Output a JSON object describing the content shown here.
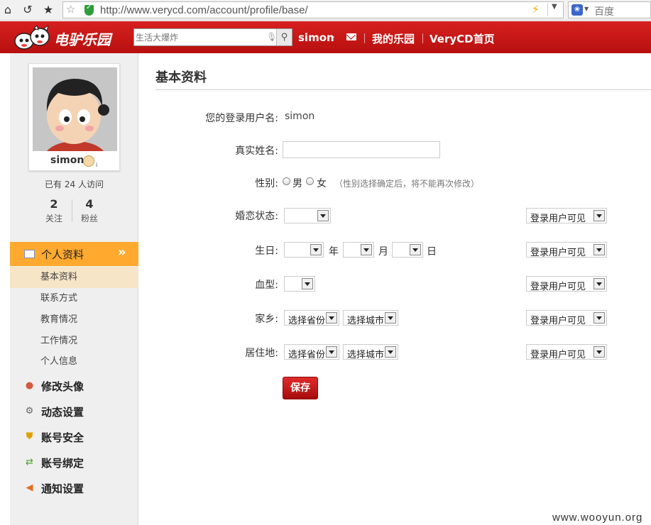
{
  "browser": {
    "url": "http://www.verycd.com/account/profile/base/",
    "search_engine": "百度",
    "icons": [
      "home-icon",
      "refresh-icon",
      "bookmark-star-icon",
      "add-bookmark-icon",
      "secure-shield-icon",
      "lightning-icon",
      "baidu-paw-icon"
    ]
  },
  "header": {
    "logo_text": "电驴乐园",
    "search_placeholder": "生活大爆炸",
    "username": "simon",
    "links": [
      "我的乐园",
      "VeryCD首页"
    ],
    "colors": {
      "header_red": "#c4161c",
      "accent_orange": "#ffa92f"
    }
  },
  "sidebar": {
    "name": "simon",
    "medal_sub": "i",
    "visits_text": "已有 24 人访问",
    "stats": [
      {
        "num": "2",
        "label": "关注"
      },
      {
        "num": "4",
        "label": "粉丝"
      }
    ],
    "active_section": "个人资料",
    "sub_items": [
      "基本资料",
      "联系方式",
      "教育情况",
      "工作情况",
      "个人信息"
    ],
    "nav_items": [
      "修改头像",
      "动态设置",
      "账号安全",
      "账号绑定",
      "通知设置"
    ]
  },
  "main": {
    "title": "基本资料",
    "labels": {
      "login_name": "您的登录用户名:",
      "real_name": "真实姓名:",
      "gender": "性别:",
      "marital": "婚恋状态:",
      "birthday": "生日:",
      "blood": "血型:",
      "hometown": "家乡:",
      "residence": "居住地:"
    },
    "login_name_value": "simon",
    "gender_options": [
      "男",
      "女"
    ],
    "gender_hint": "（性别选择确定后，将不能再次修改）",
    "date_units": [
      "年",
      "月",
      "日"
    ],
    "province_placeholder": "选择省份",
    "city_placeholder": "选择城市",
    "visibility": "登录用户可见",
    "save_label": "保存"
  },
  "watermark": "www.wooyun.org"
}
